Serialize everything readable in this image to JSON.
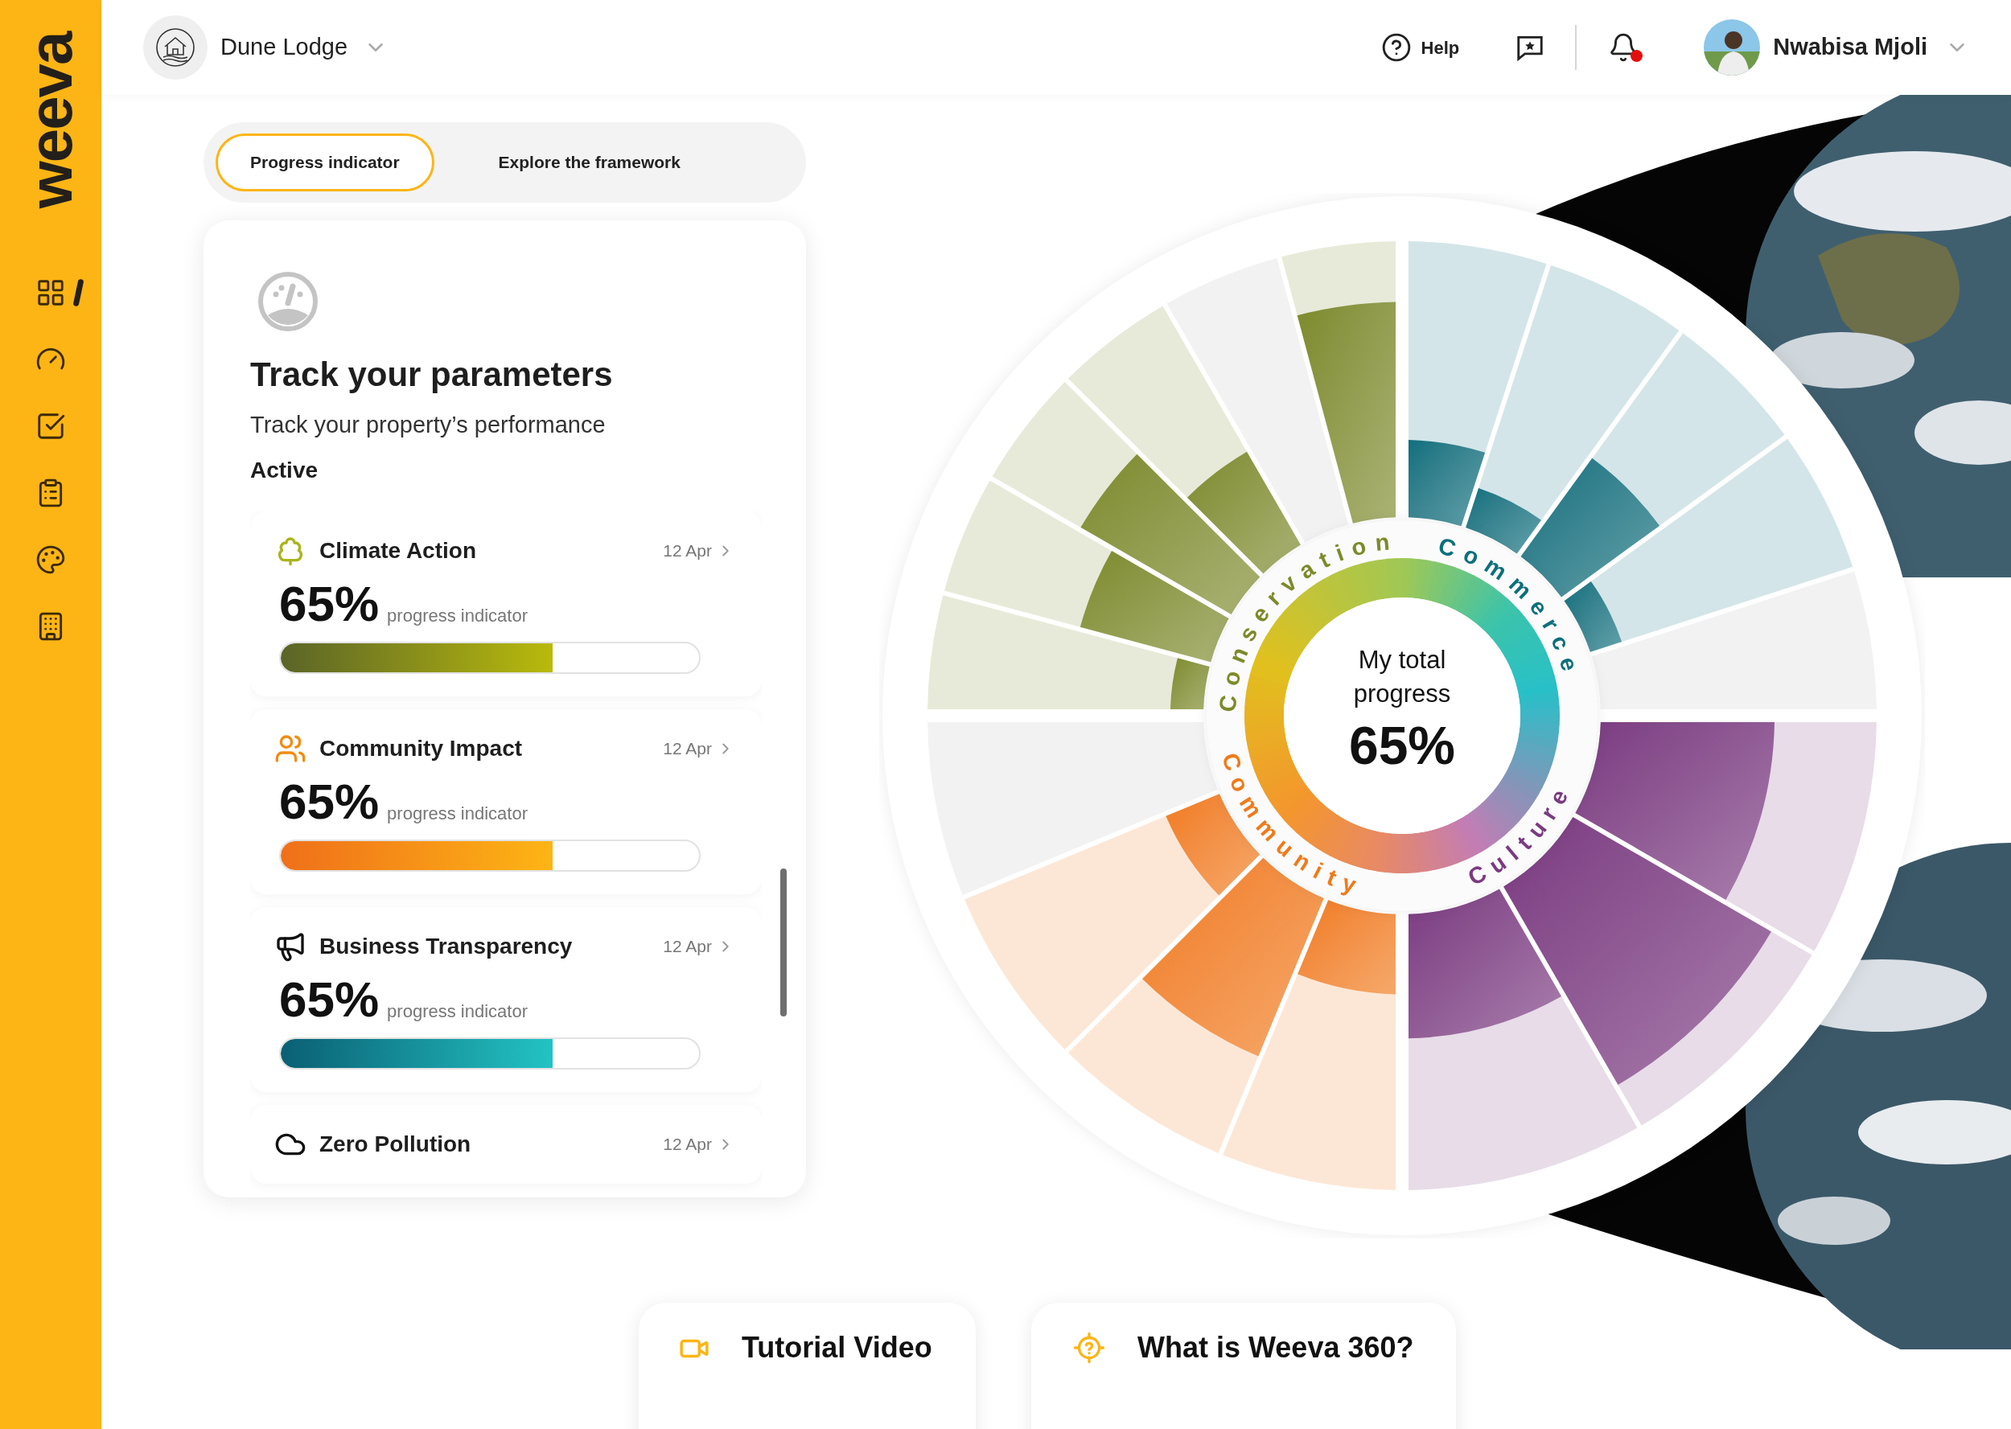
{
  "logo": {
    "text": "weeva"
  },
  "sidebar": {
    "items": [
      {
        "kind": "grid",
        "selected": true
      },
      {
        "kind": "gauge",
        "selected": false
      },
      {
        "kind": "checklist",
        "selected": false
      },
      {
        "kind": "clipboard",
        "selected": false
      },
      {
        "kind": "palette",
        "selected": false
      },
      {
        "kind": "building",
        "selected": false
      }
    ]
  },
  "topbar": {
    "property": {
      "name": "Dune Lodge"
    },
    "help": "Help",
    "notifications": {
      "unread": true
    },
    "user": {
      "name": "Nwabisa Mjoli"
    }
  },
  "tabs": [
    {
      "label": "Progress indicator",
      "selected": true
    },
    {
      "label": "Explore the framework",
      "selected": false
    }
  ],
  "tracker": {
    "title": "Track your parameters",
    "subtitle": "Track your property’s performance",
    "status": "Active",
    "items": [
      {
        "kind": "tree",
        "title": "Climate Action",
        "date": "12 Apr",
        "percent": "65%",
        "caption": "progress indicator",
        "level": 0.65
      },
      {
        "kind": "people",
        "title": "Community Impact",
        "date": "12 Apr",
        "percent": "65%",
        "caption": "progress indicator",
        "level": 0.65
      },
      {
        "kind": "megaphone",
        "title": "Business Transparency",
        "date": "12 Apr",
        "percent": "65%",
        "caption": "progress indicator",
        "level": 0.65
      },
      {
        "kind": "cloud",
        "title": "Zero Pollution",
        "date": "12 Apr"
      }
    ]
  },
  "wheel": {
    "categories": [
      {
        "name": "Conservation",
        "color": "#7d8a2a"
      },
      {
        "name": "Commerce",
        "color": "#0d6f7d"
      },
      {
        "name": "Community",
        "color": "#f07a1a"
      },
      {
        "name": "Culture",
        "color": "#7a3a80"
      }
    ],
    "center": {
      "label": "My total progress",
      "value": "65%"
    }
  },
  "cards": [
    {
      "kind": "video",
      "title": "Tutorial Video"
    },
    {
      "kind": "help",
      "title": "What is Weeva 360?"
    }
  ]
}
